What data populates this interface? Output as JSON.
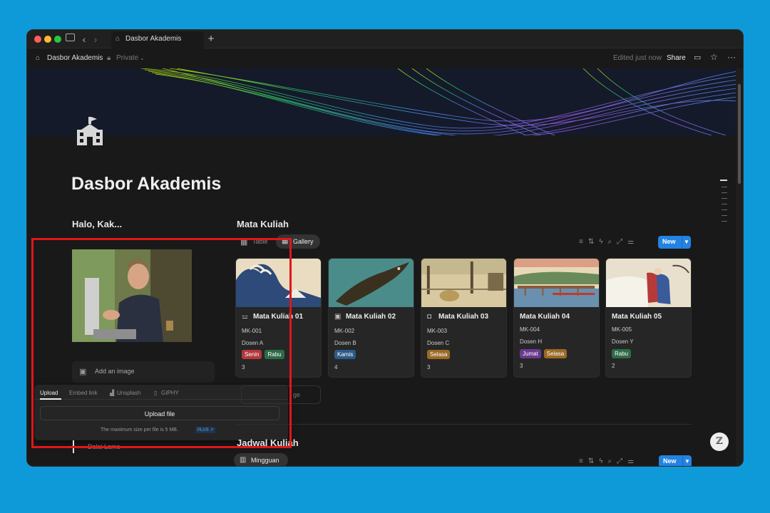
{
  "browser": {
    "tab_title": "Dasbor Akademis",
    "new_tab": "+"
  },
  "topbar": {
    "page_name": "Dasbor Akademis",
    "privacy": "Private",
    "edited": "Edited just now",
    "share": "Share"
  },
  "page": {
    "title": "Dasbor Akademis",
    "greeting": "Halo, Kak..."
  },
  "image_block": {
    "add_label": "Add an image",
    "partial_hint": "ge"
  },
  "upload_popup": {
    "tabs": [
      "Upload",
      "Embed link",
      "Unsplash",
      "GIPHY"
    ],
    "upload_button": "Upload file",
    "max_size_note": "The maximum size per file is 5 MB.",
    "plus_badge": "PLUS ↗"
  },
  "courses": {
    "heading": "Mata Kuliah",
    "views": [
      "Table",
      "Gallery"
    ],
    "new_label": "New",
    "cards": [
      {
        "title": "Mata Kuliah 01",
        "code": "MK-001",
        "lecturer": "Dosen A",
        "tags": [
          {
            "text": "Senin",
            "color": "#b3373d"
          },
          {
            "text": "Rabu",
            "color": "#2e6b47"
          }
        ],
        "count": "3",
        "icon": "sliders-icon"
      },
      {
        "title": "Mata Kuliah 02",
        "code": "MK-002",
        "lecturer": "Dosen B",
        "tags": [
          {
            "text": "Kamis",
            "color": "#2c5a86"
          }
        ],
        "count": "4",
        "icon": "image-icon"
      },
      {
        "title": "Mata Kuliah 03",
        "code": "MK-003",
        "lecturer": "Dosen C",
        "tags": [
          {
            "text": "Selasa",
            "color": "#9a6a25"
          }
        ],
        "count": "3",
        "icon": "robot-icon"
      },
      {
        "title": "Mata Kuliah 04",
        "code": "MK-004",
        "lecturer": "Dosen H",
        "tags": [
          {
            "text": "Jumat",
            "color": "#6a3a8f"
          },
          {
            "text": "Selasa",
            "color": "#9a6a25"
          }
        ],
        "count": "3",
        "icon": ""
      },
      {
        "title": "Mata Kuliah 05",
        "code": "MK-005",
        "lecturer": "Dosen Y",
        "tags": [
          {
            "text": "Rabu",
            "color": "#2e6b47"
          }
        ],
        "count": "2",
        "icon": ""
      }
    ]
  },
  "schedule": {
    "heading": "Jadwal Kuliah",
    "view": "Mingguan",
    "new_label": "New",
    "partial_item": "Dalai Lama"
  },
  "colors": {
    "accent": "#2383e2",
    "highlight_box": "#e0161b",
    "background": "#0e9ad8"
  }
}
